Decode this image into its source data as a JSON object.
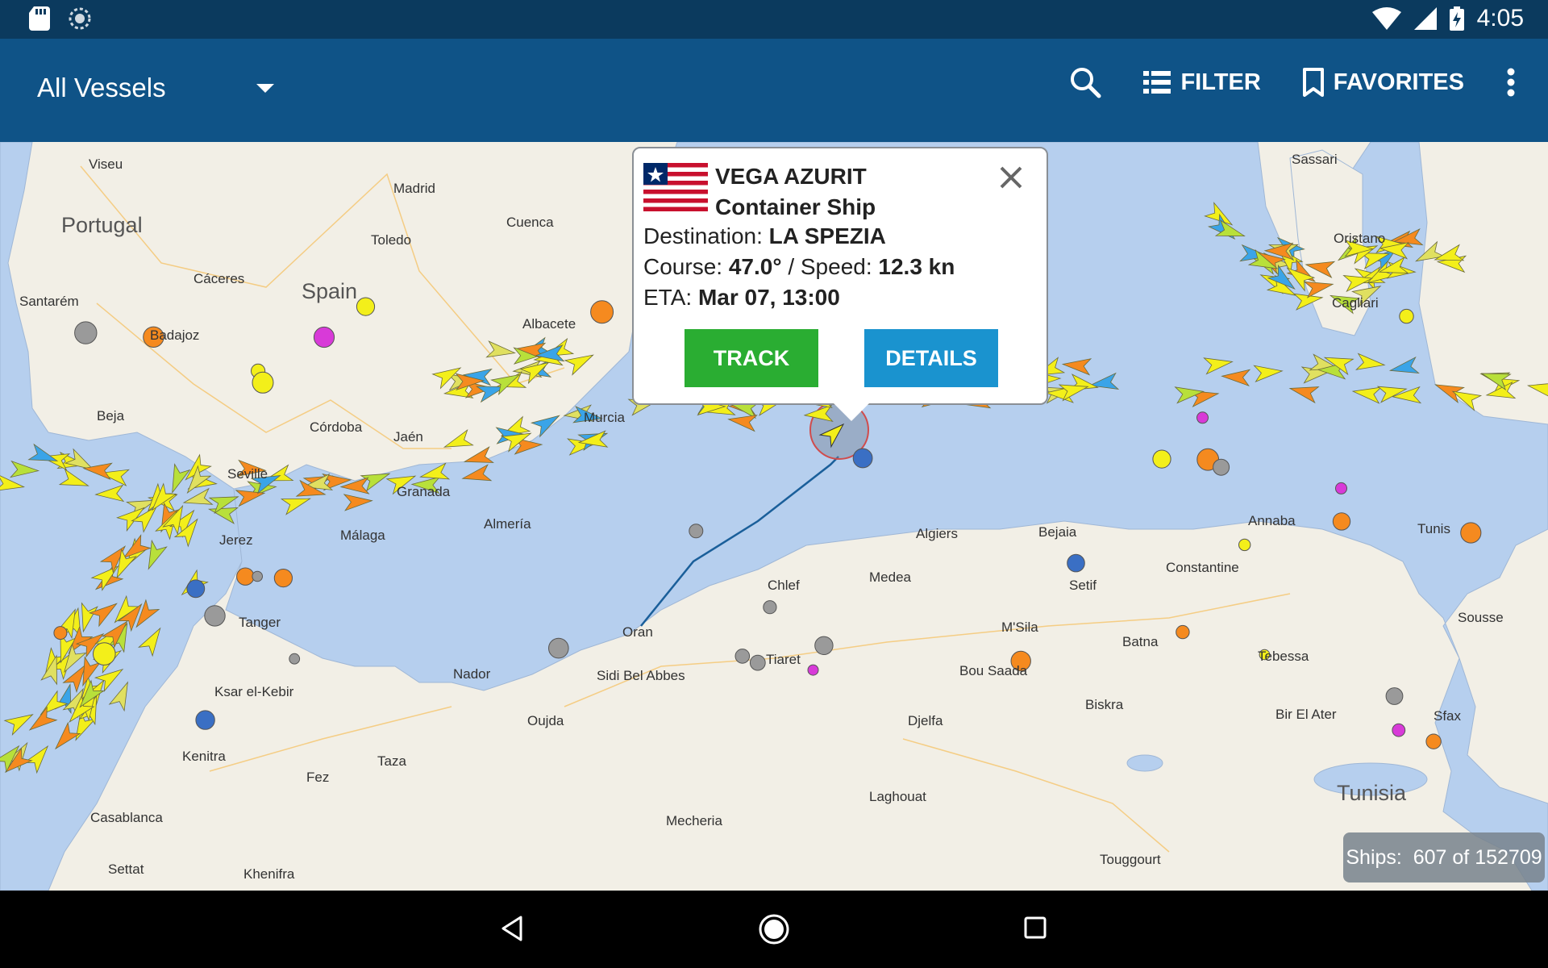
{
  "status_bar": {
    "time": "4:05",
    "icons": [
      "sd-card-icon",
      "sync-icon",
      "wifi-icon",
      "signal-icon",
      "battery-charging-icon"
    ]
  },
  "app_bar": {
    "vessel_filter": "All Vessels",
    "filter_label": "FILTER",
    "favorites_label": "FAVORITES",
    "icons": [
      "search-icon",
      "list-icon",
      "bookmark-icon",
      "more-vert-icon"
    ]
  },
  "popup": {
    "vessel_name": "VEGA AZURIT",
    "vessel_type": "Container Ship",
    "destination_label": "Destination:",
    "destination": "LA SPEZIA",
    "course_label": "Course:",
    "course": "47.0°",
    "speed_sep": "/ Speed:",
    "speed": "12.3 kn",
    "eta_label": "ETA:",
    "eta": "Mar 07, 13:00",
    "track_label": "TRACK",
    "details_label": "DETAILS",
    "flag": "liberia-flag-icon"
  },
  "map": {
    "countries": [
      "Portugal",
      "Spain",
      "Tunisia"
    ],
    "cities": [
      "Viseu",
      "Madrid",
      "Cuenca",
      "Toledo",
      "Cáceres",
      "Santarém",
      "Badajoz",
      "Albacete",
      "Beja",
      "Córdoba",
      "Jaén",
      "Murcia",
      "Seville",
      "Granada",
      "Málaga",
      "Almería",
      "Jerez",
      "Tanger",
      "Ksar el-Kebir",
      "Nador",
      "Oujda",
      "Sidi Bel Abbes",
      "Oran",
      "Chlef",
      "Tiaret",
      "Medea",
      "Algiers",
      "Bejaia",
      "Setif",
      "Constantine",
      "Annaba",
      "M'Sila",
      "Batna",
      "Bou Saada",
      "Biskra",
      "Djelfa",
      "Tebessa",
      "Bir El Ater",
      "Laghouat",
      "Touggourt",
      "Mecheria",
      "Taza",
      "Fez",
      "Kenitra",
      "Casablanca",
      "Settat",
      "Khenifra",
      "Sassari",
      "Oristano",
      "Cagliari",
      "Sfax",
      "Sousse",
      "Tunis"
    ],
    "ships_label": "Ships:",
    "ships_count": "607 of 152709"
  },
  "nav_bar": {
    "icons": [
      "back-icon",
      "home-icon",
      "recents-icon"
    ]
  },
  "colors": {
    "status_bar": "#0b3a5e",
    "app_bar": "#0f5387",
    "sea": "#b6cfee",
    "land": "#f2efe6",
    "track_button": "#2aad32",
    "details_button": "#1a93cf"
  }
}
